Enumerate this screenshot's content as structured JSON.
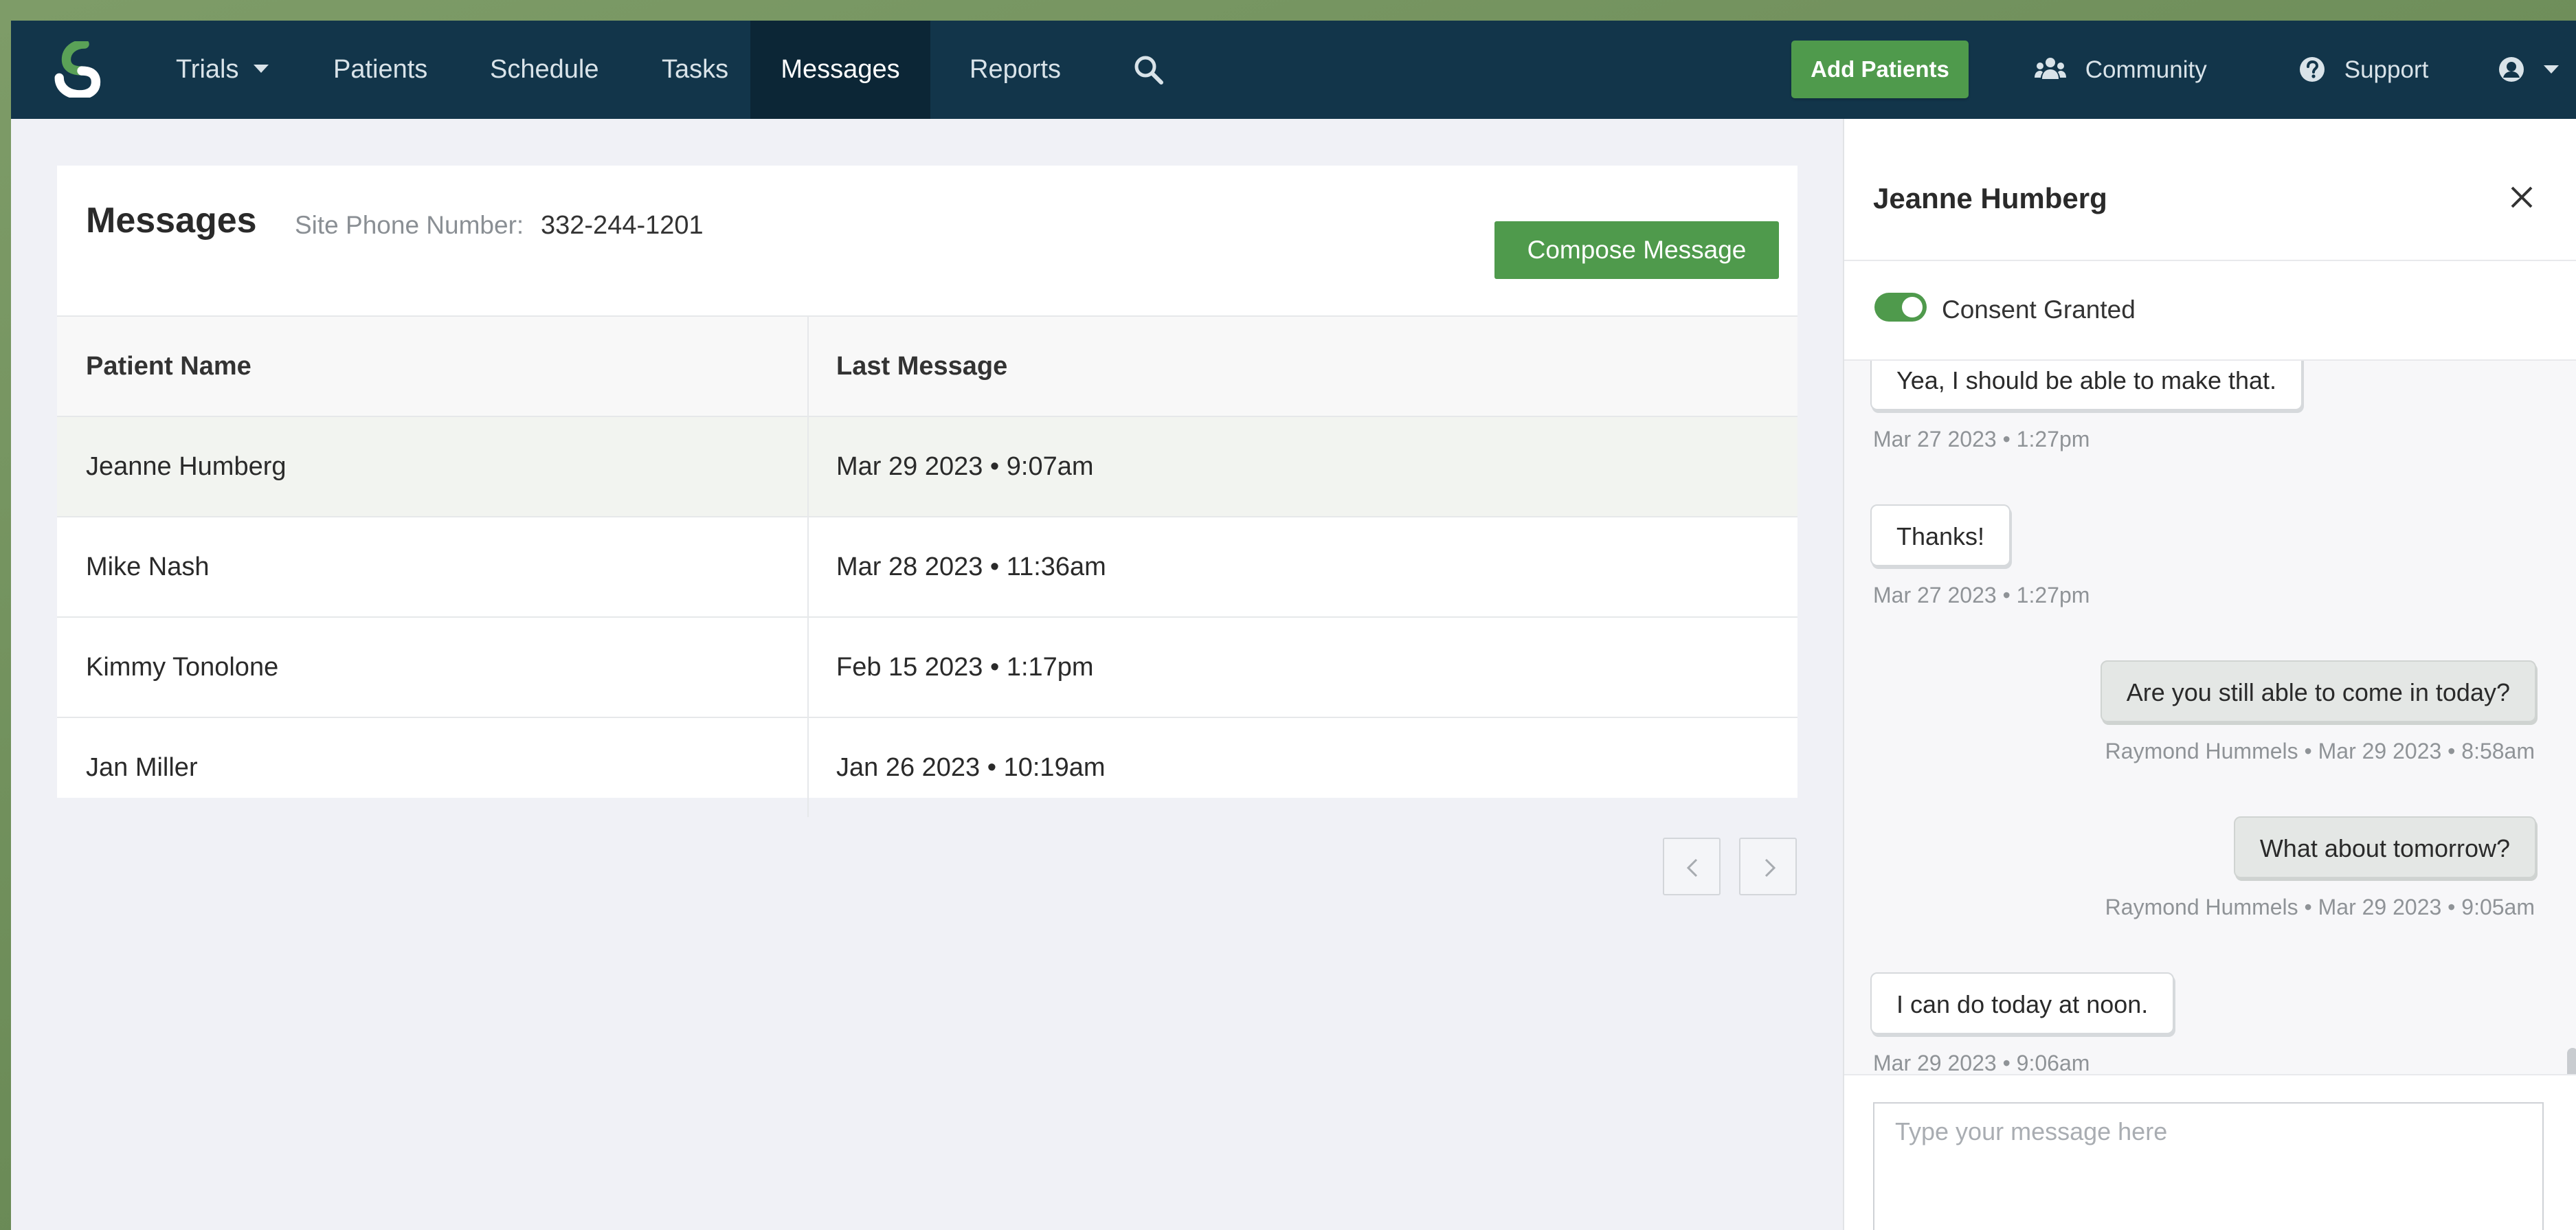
{
  "navbar": {
    "items": [
      {
        "label": "Trials"
      },
      {
        "label": "Patients"
      },
      {
        "label": "Schedule"
      },
      {
        "label": "Tasks"
      },
      {
        "label": "Messages"
      },
      {
        "label": "Reports"
      }
    ],
    "active_item": "Messages",
    "add_patients_label": "Add Patients",
    "community_label": "Community",
    "support_label": "Support"
  },
  "messages": {
    "title": "Messages",
    "site_phone_label": "Site Phone Number:",
    "site_phone_value": "332-244-1201",
    "compose_label": "Compose Message",
    "columns": [
      "Patient Name",
      "Last Message"
    ],
    "rows": [
      {
        "name": "Jeanne Humberg",
        "last": "Mar 29 2023 • 9:07am"
      },
      {
        "name": "Mike Nash",
        "last": "Mar 28 2023 • 11:36am"
      },
      {
        "name": "Kimmy Tonolone",
        "last": "Feb 15 2023 • 1:17pm"
      },
      {
        "name": "Jan Miller",
        "last": "Jan 26 2023 • 10:19am"
      }
    ]
  },
  "panel": {
    "title": "Jeanne Humberg",
    "consent_label": "Consent Granted",
    "consent_enabled": true,
    "messages": [
      {
        "direction": "in",
        "text": "Yea, I should be able to make that.",
        "meta": "Mar 27 2023 • 1:27pm"
      },
      {
        "direction": "in",
        "text": "Thanks!",
        "meta": "Mar 27 2023 • 1:27pm"
      },
      {
        "direction": "out",
        "text": "Are you still able to come in today?",
        "meta": "Raymond Hummels • Mar 29 2023 • 8:58am"
      },
      {
        "direction": "out",
        "text": "What about tomorrow?",
        "meta": "Raymond Hummels • Mar 29 2023 • 9:05am"
      },
      {
        "direction": "in",
        "text": "I can do today at noon.",
        "meta": "Mar 29 2023 • 9:06am"
      }
    ],
    "composer_placeholder": "Type your message here"
  },
  "colors": {
    "navbar": "#12354a",
    "navbar_active": "#0c2636",
    "accent_green": "#4f9a4c",
    "page_background": "#f0f1f6"
  }
}
